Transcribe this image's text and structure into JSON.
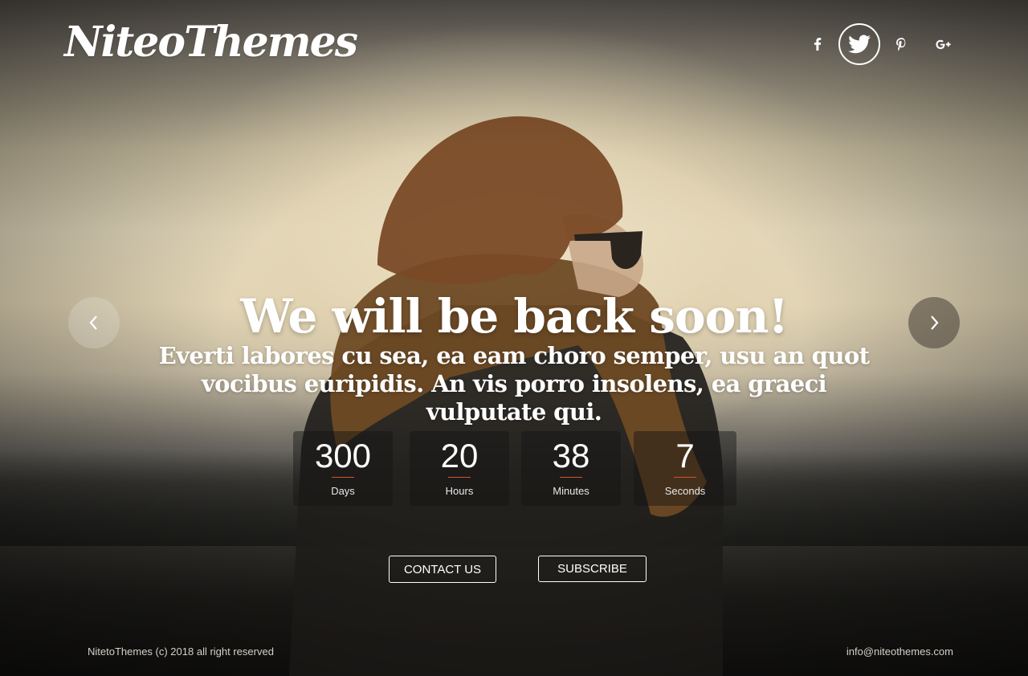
{
  "brand": {
    "logo_text": "NiteoThemes"
  },
  "social": [
    {
      "name": "facebook-icon",
      "glyph": "f"
    },
    {
      "name": "twitter-icon",
      "glyph": "twitter",
      "active": true
    },
    {
      "name": "pinterest-icon",
      "glyph": "p"
    },
    {
      "name": "google-plus-icon",
      "glyph": "g+"
    }
  ],
  "hero": {
    "headline": "We will be back soon!",
    "subline": "Everti labores cu sea, ea eam choro semper, usu an quot vocibus euripidis. An vis porro insolens, ea graeci vulputate qui."
  },
  "countdown": [
    {
      "value": "300",
      "label": "Days"
    },
    {
      "value": "20",
      "label": "Hours"
    },
    {
      "value": "38",
      "label": "Minutes"
    },
    {
      "value": "7",
      "label": "Seconds"
    }
  ],
  "buttons": {
    "contact": "CONTACT US",
    "subscribe": "SUBSCRIBE"
  },
  "footer": {
    "copyright": "NitetoThemes (c) 2018 all right reserved",
    "email": "info@niteothemes.com"
  },
  "colors": {
    "accent": "#d9502b",
    "text": "#ffffff"
  }
}
